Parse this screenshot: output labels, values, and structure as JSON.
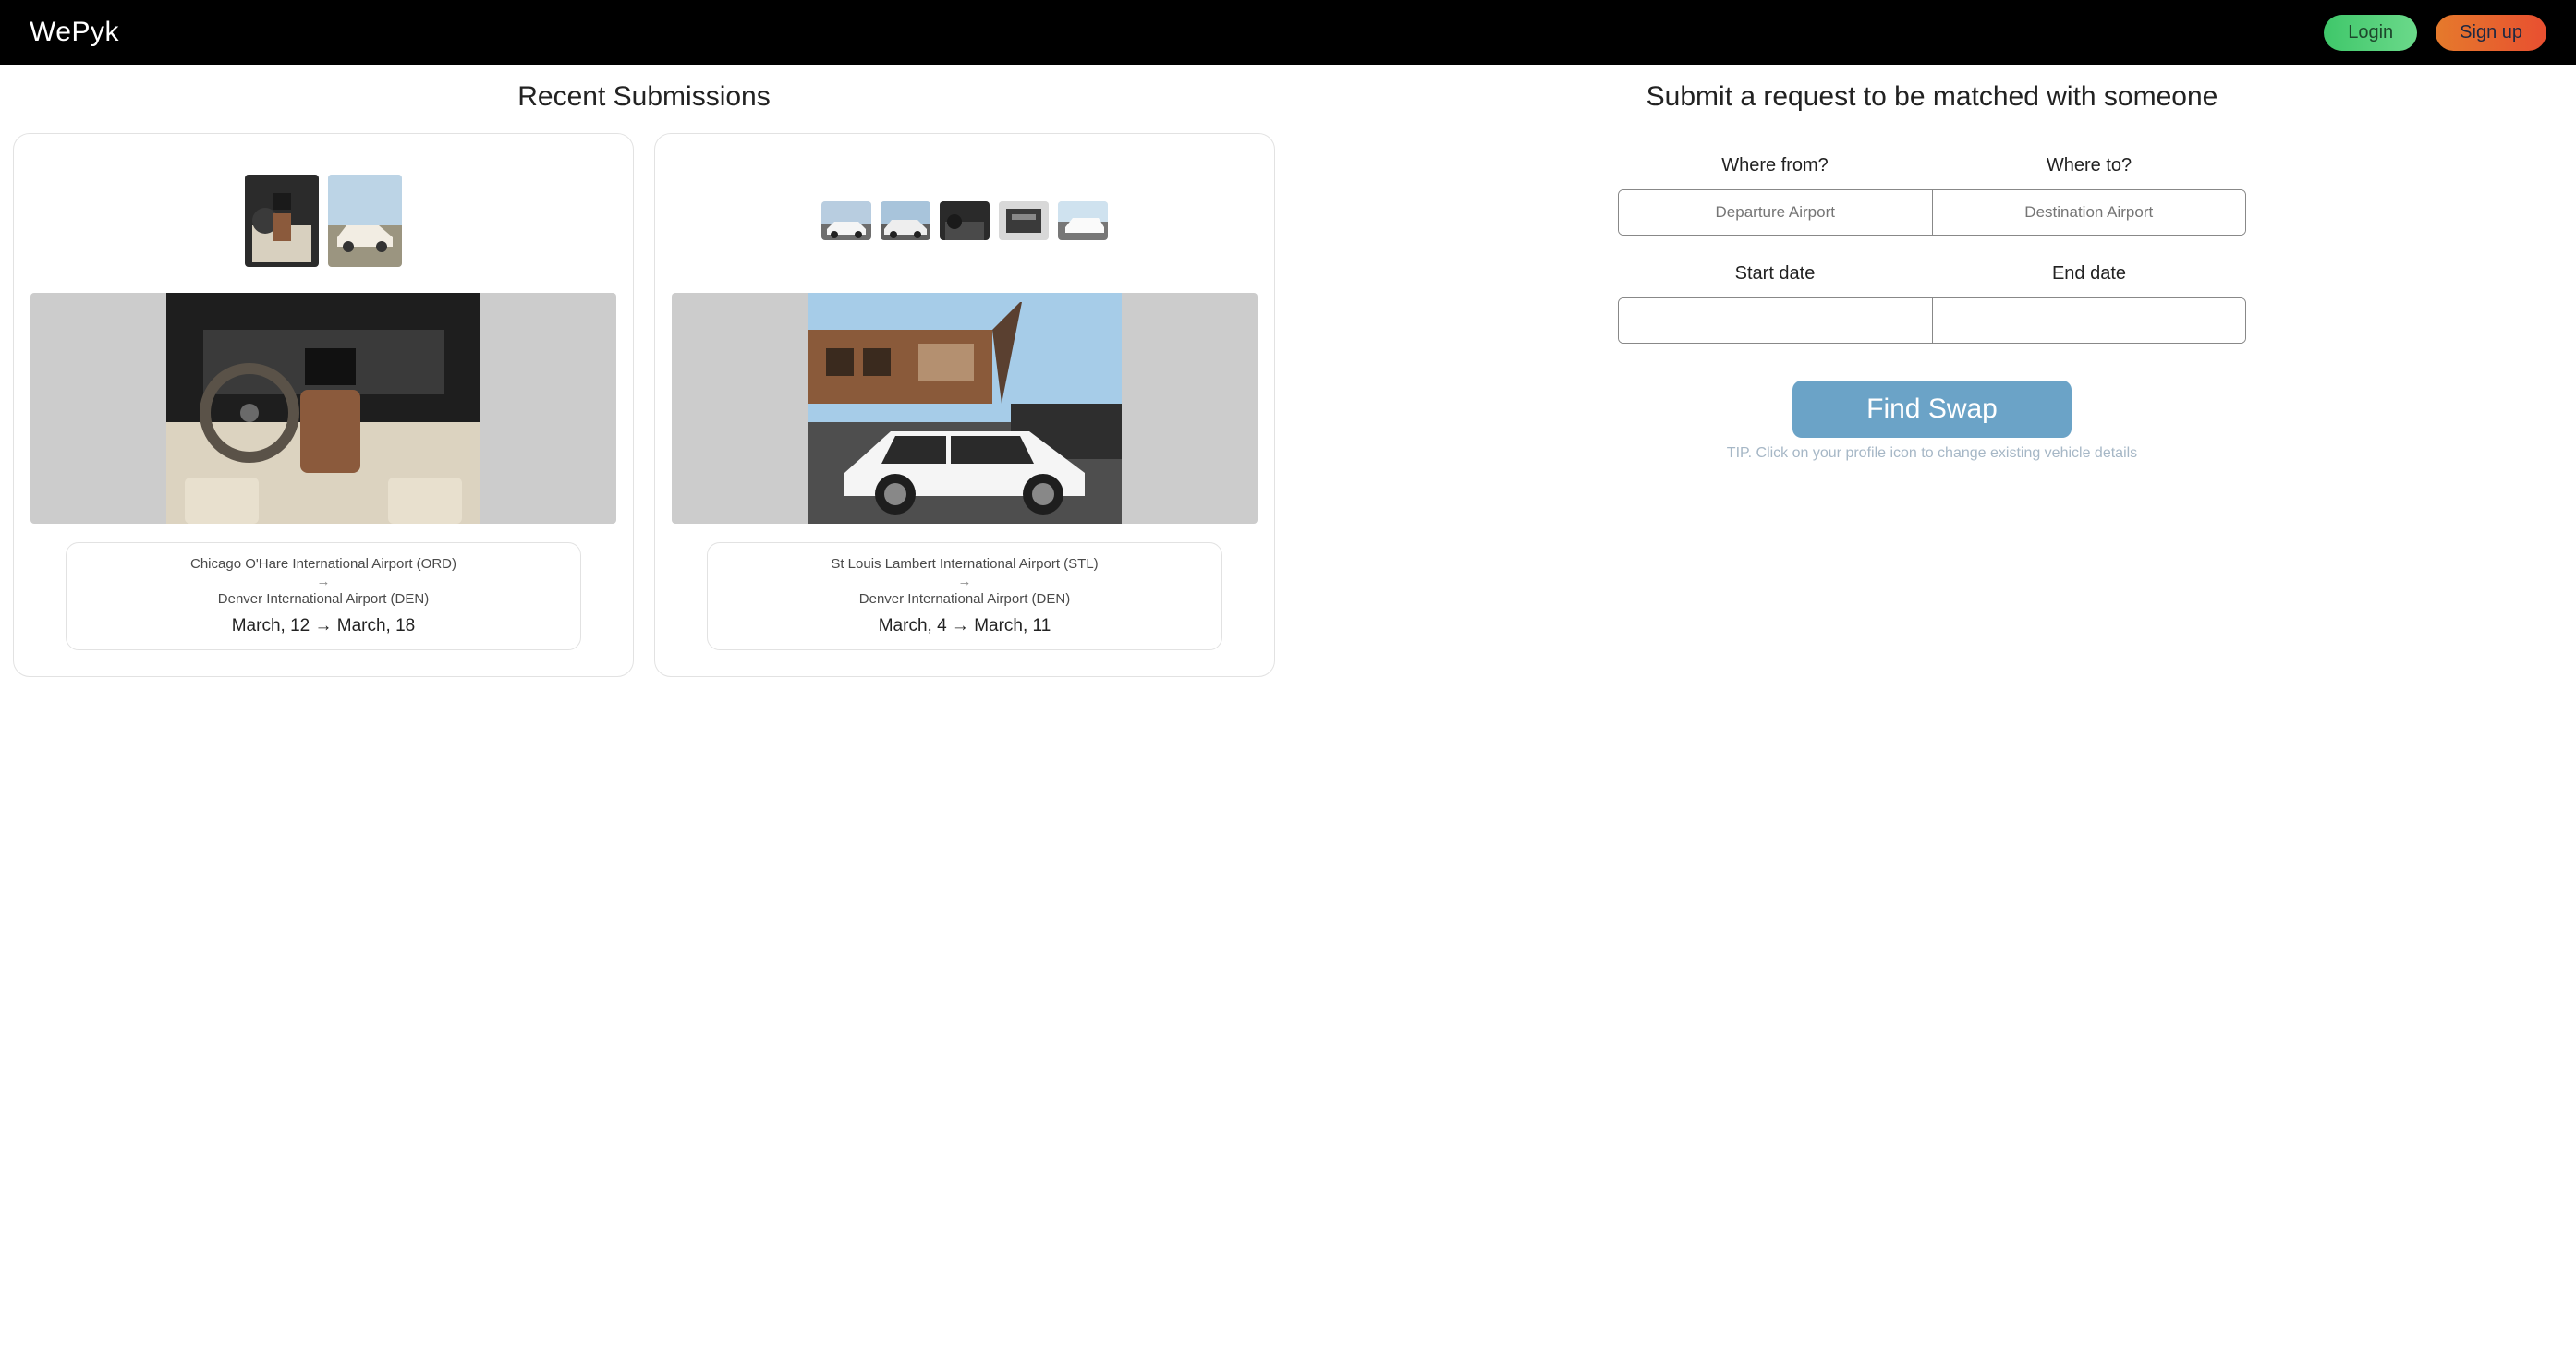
{
  "nav": {
    "logo": "WePyk",
    "login_label": "Login",
    "signup_label": "Sign up"
  },
  "left": {
    "title": "Recent Submissions",
    "cards": [
      {
        "from_airport": "Chicago O'Hare International Airport (ORD)",
        "to_airport": "Denver International Airport (DEN)",
        "date_range": "March, 12 → March, 18"
      },
      {
        "from_airport": "St Louis Lambert International Airport (STL)",
        "to_airport": "Denver International Airport (DEN)",
        "date_range": "March, 4 → March, 11"
      }
    ]
  },
  "right": {
    "title": "Submit a request to be matched with someone",
    "where_from_label": "Where from?",
    "where_to_label": "Where to?",
    "from_placeholder": "Departure Airport",
    "to_placeholder": "Destination Airport",
    "start_date_label": "Start date",
    "end_date_label": "End date",
    "find_label": "Find Swap",
    "tip": "TIP. Click on your profile icon to change existing vehicle details"
  },
  "arrow_symbol": "→"
}
